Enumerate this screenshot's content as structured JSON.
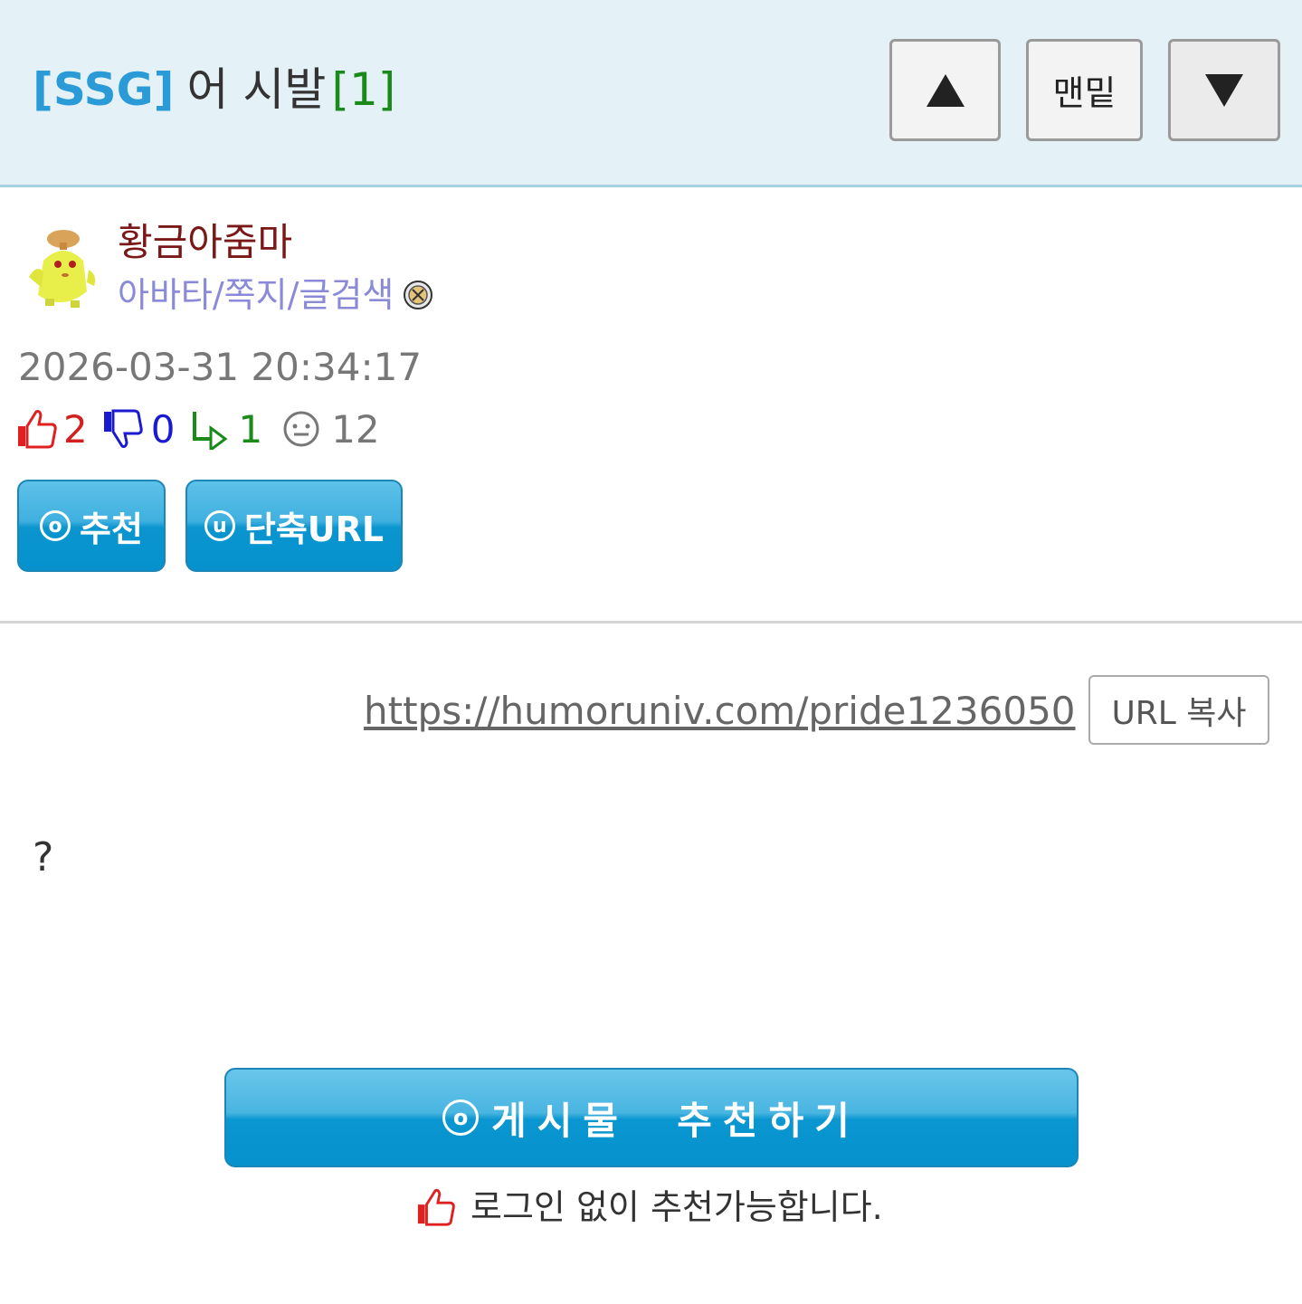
{
  "header": {
    "category_tag": "[SSG]",
    "subject": "어 시발",
    "comment_count": "[1]",
    "nav": {
      "up_icon": "triangle-up-icon",
      "bottom_label": "맨밑",
      "down_icon": "triangle-down-icon"
    }
  },
  "author": {
    "nickname": "황금아줌마",
    "links": "아바타/쪽지/글검색",
    "avatar_icon": "pokemon-sprite-avatar",
    "badge_icon": "member-badge-icon"
  },
  "post": {
    "datetime": "2026-03-31 20:34:17",
    "stats": {
      "recommend": "2",
      "dislike": "0",
      "replies": "1",
      "views": "12"
    }
  },
  "actions": {
    "recommend_label": "추천",
    "recommend_circle": "o",
    "short_url_label": "단축URL",
    "short_url_circle": "u"
  },
  "url_section": {
    "url": "https://humoruniv.com/pride1236050",
    "copy_label": "URL 복사"
  },
  "content": {
    "body": "?"
  },
  "footer": {
    "big_button_label": "게시물  추천하기",
    "big_button_circle": "o",
    "note": "로그인 없이 추천가능합니다."
  },
  "colors": {
    "header_bg": "#e4f2f8",
    "tag_blue": "#2a9bd7",
    "count_green": "#1a8a1a",
    "nickname_red": "#7a1818",
    "link_purple": "#8a8ad8",
    "button_blue": "#0592cd"
  }
}
